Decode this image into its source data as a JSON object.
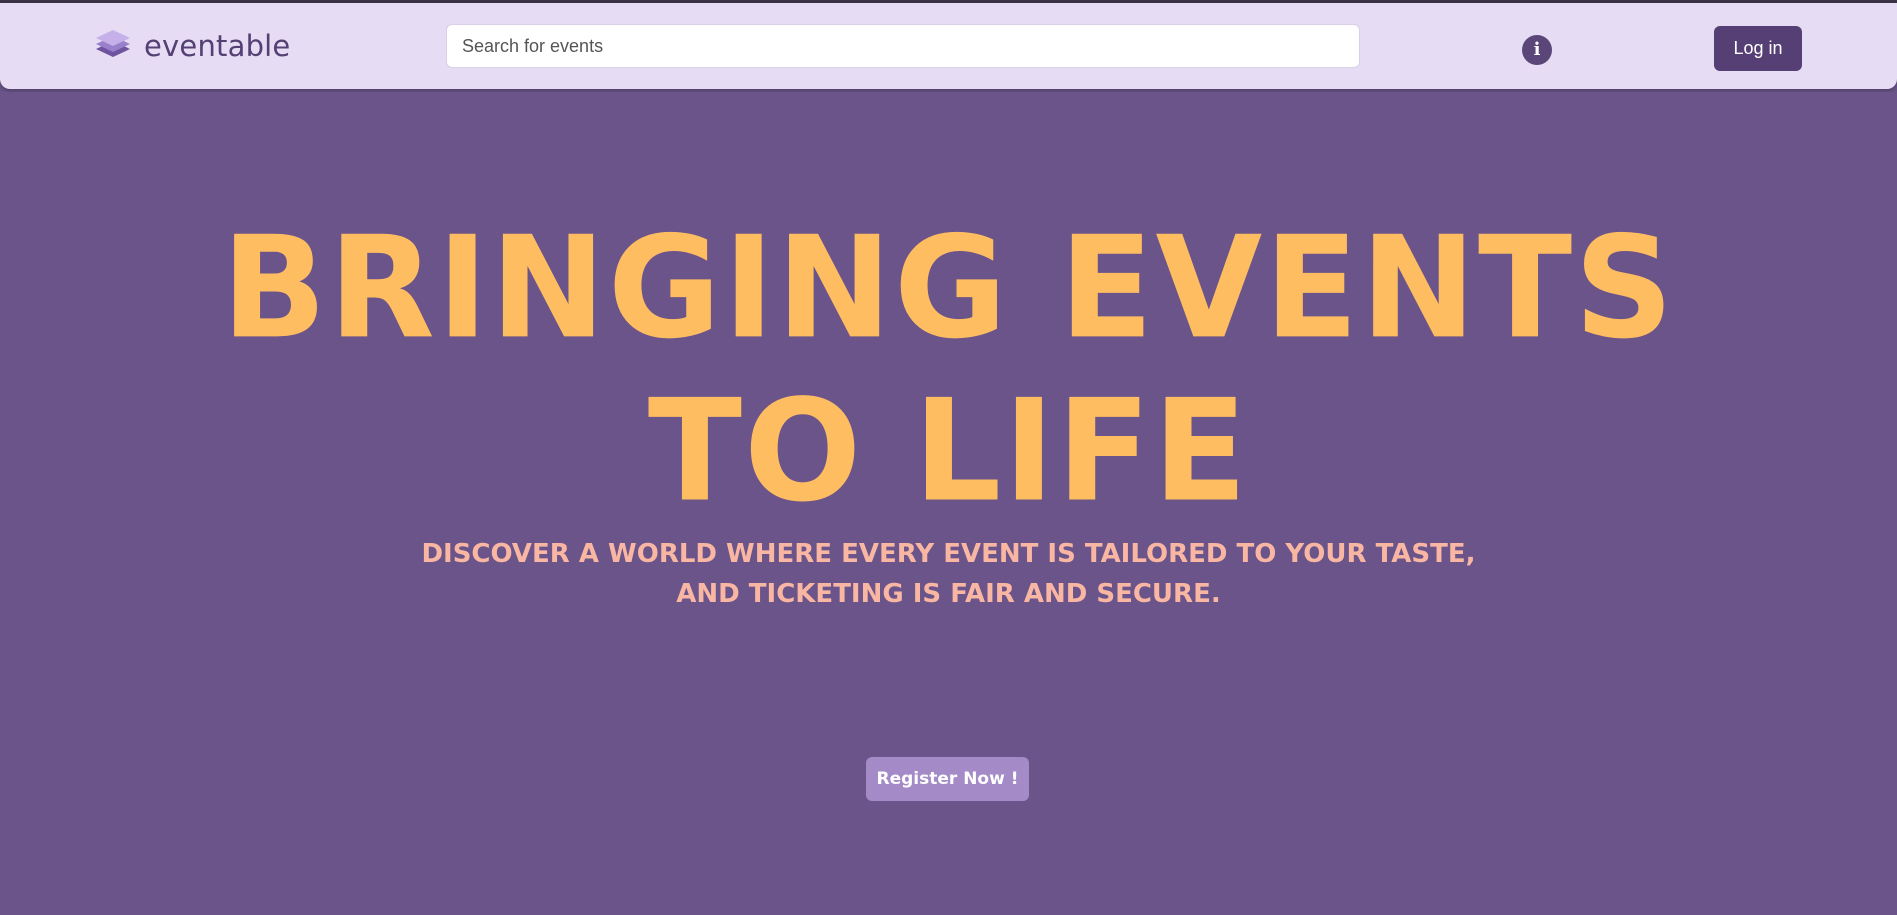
{
  "brand": {
    "name": "eventable",
    "icon": "layers-icon"
  },
  "search": {
    "placeholder": "Search for events",
    "value": ""
  },
  "header": {
    "info_icon": "info-icon",
    "info_glyph": "i",
    "login_label": "Log in"
  },
  "hero": {
    "title_lines": [
      "BRINGING EVENTS",
      "TO LIFE"
    ],
    "subtitle_lines": [
      "DISCOVER A WORLD WHERE EVERY EVENT IS TAILORED TO YOUR TASTE,",
      "AND TICKETING IS FAIR AND SECURE."
    ],
    "cta_label": "Register Now !"
  },
  "colors": {
    "hero_background": "#6a5489",
    "navbar_background": "#e6dcf3",
    "title": "#ffbd62",
    "subtitle": "#f9b7a3",
    "primary_button": "#553f74",
    "cta_button": "#a48ac7"
  }
}
